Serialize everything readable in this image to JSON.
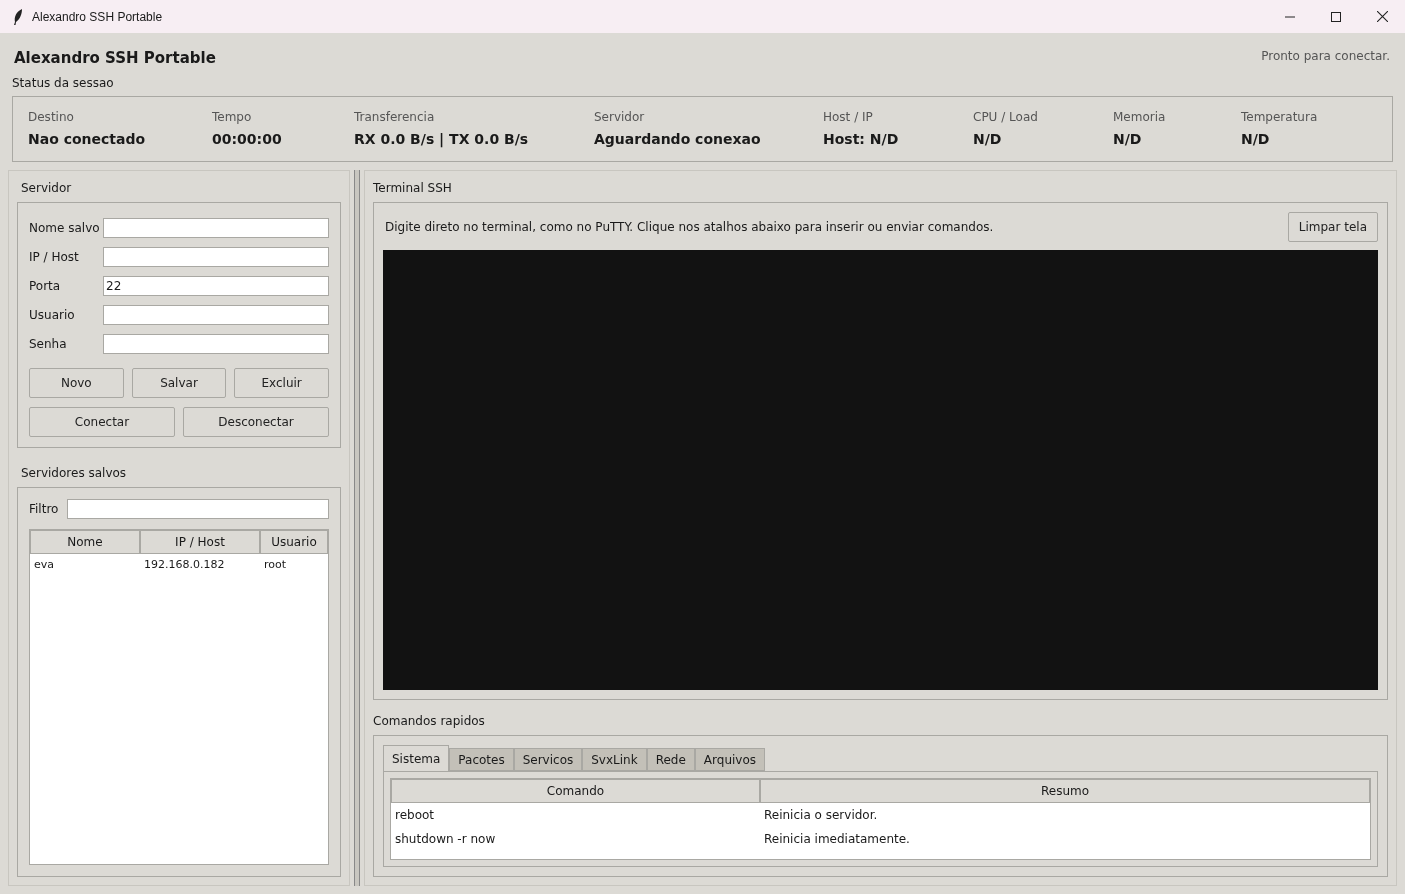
{
  "window": {
    "title": "Alexandro SSH Portable"
  },
  "header": {
    "title": "Alexandro SSH Portable",
    "status": "Pronto para conectar."
  },
  "session": {
    "title": "Status da sessao",
    "stats": [
      {
        "label": "Destino",
        "value": "Nao conectado"
      },
      {
        "label": "Tempo",
        "value": "00:00:00"
      },
      {
        "label": "Transferencia",
        "value": "RX 0.0 B/s | TX 0.0 B/s"
      },
      {
        "label": "Servidor",
        "value": "Aguardando conexao"
      },
      {
        "label": "Host / IP",
        "value": "Host: N/D"
      },
      {
        "label": "CPU / Load",
        "value": "N/D"
      },
      {
        "label": "Memoria",
        "value": "N/D"
      },
      {
        "label": "Temperatura",
        "value": "N/D"
      }
    ]
  },
  "server": {
    "title": "Servidor",
    "fields": [
      {
        "label": "Nome salvo"
      },
      {
        "label": "IP / Host"
      },
      {
        "label": "Porta",
        "value": "22"
      },
      {
        "label": "Usuario"
      },
      {
        "label": "Senha"
      }
    ],
    "buttons_row1": [
      "Novo",
      "Salvar",
      "Excluir"
    ],
    "buttons_row2": [
      "Conectar",
      "Desconectar"
    ]
  },
  "saved": {
    "title": "Servidores salvos",
    "filter_label": "Filtro",
    "table": {
      "columns": [
        "Nome",
        "IP / Host",
        "Usuario"
      ],
      "rows": [
        [
          "eva",
          "192.168.0.182",
          "root"
        ]
      ]
    }
  },
  "terminal": {
    "title": "Terminal SSH",
    "hint": "Digite direto no terminal, como no PuTTY. Clique nos atalhos abaixo para inserir ou enviar comandos.",
    "clear_button": "Limpar tela"
  },
  "quick": {
    "title": "Comandos rapidos",
    "tabs": [
      {
        "label": "Sistema",
        "selected": true
      },
      {
        "label": "Pacotes",
        "selected": false
      },
      {
        "label": "Servicos",
        "selected": false
      },
      {
        "label": "SvxLink",
        "selected": false
      },
      {
        "label": "Rede",
        "selected": false
      },
      {
        "label": "Arquivos",
        "selected": false
      }
    ],
    "table": {
      "columns": [
        "Comando",
        "Resumo"
      ],
      "rows": [
        [
          "reboot",
          "Reinicia o servidor."
        ],
        [
          "shutdown -r now",
          "Reinicia imediatamente."
        ]
      ]
    }
  }
}
